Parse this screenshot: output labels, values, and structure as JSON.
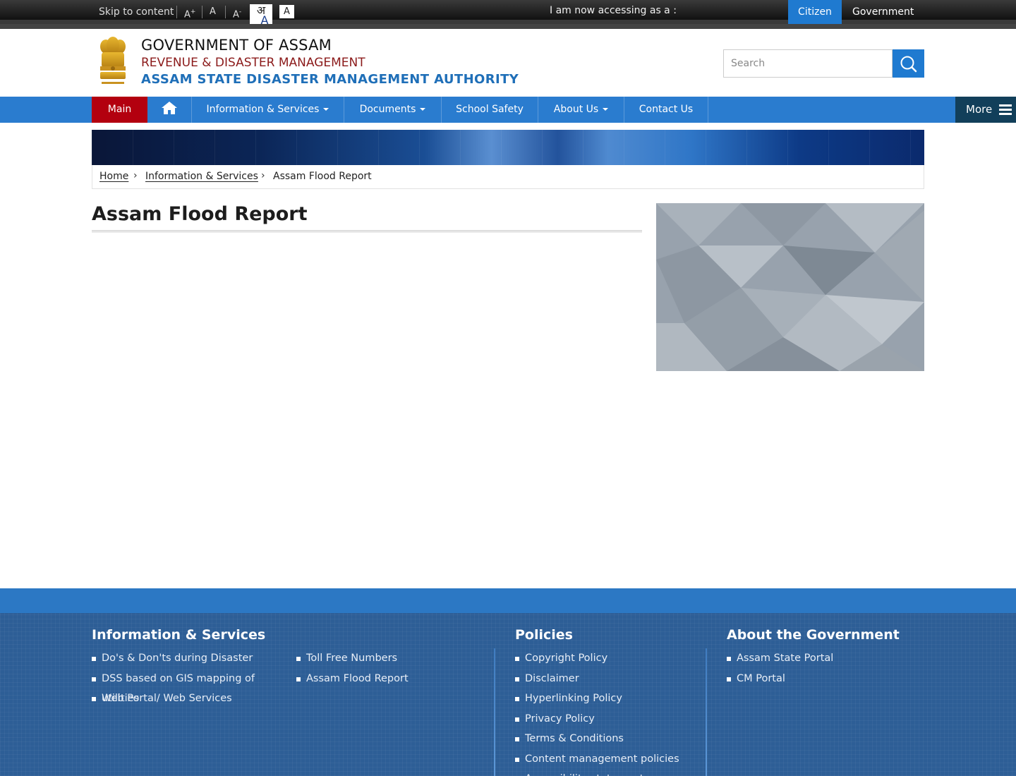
{
  "topbar": {
    "skip_label": "Skip to content",
    "font_increase": "A+",
    "font_normal": "A",
    "font_decrease": "A-",
    "lang_hindi": "अ",
    "lang_english": "A",
    "contrast": "A",
    "accessing_label": "I am now accessing as a :",
    "citizen_label": "Citizen",
    "government_label": "Government"
  },
  "header": {
    "line1": "GOVERNMENT OF ASSAM",
    "line2": "REVENUE & DISASTER MANAGEMENT",
    "line3": "ASSAM STATE DISASTER MANAGEMENT AUTHORITY",
    "search_placeholder": "Search"
  },
  "nav": {
    "main": "Main",
    "info": "Information & Services",
    "docs": "Documents",
    "school": "School Safety",
    "about": "About Us",
    "contact": "Contact Us",
    "more": "More"
  },
  "breadcrumb": {
    "home": "Home",
    "section": "Information & Services",
    "current": "Assam Flood Report"
  },
  "page": {
    "title": "Assam Flood Report"
  },
  "footer": {
    "col1": {
      "heading": "Information & Services",
      "left_items": [
        "Do's & Don'ts during Disaster",
        "DSS based on GIS mapping of utilities",
        "Web Portal/ Web Services"
      ],
      "right_items": [
        "Toll Free Numbers",
        "Assam Flood Report"
      ]
    },
    "col2": {
      "heading": "Policies",
      "items": [
        "Copyright Policy",
        "Disclaimer",
        "Hyperlinking Policy",
        "Privacy Policy",
        "Terms & Conditions",
        "Content management policies",
        "Accessibility statement"
      ]
    },
    "col3": {
      "heading": "About the Government",
      "items": [
        "Assam State Portal",
        "CM Portal"
      ]
    }
  },
  "colors": {
    "nav_blue": "#2a7ccf",
    "nav_active_red": "#b3000f",
    "citizen_blue": "#1f7ad0",
    "footer_blue": "#2d5e96",
    "title_red": "#8b1a1a",
    "title_blue": "#1f6fb8"
  }
}
